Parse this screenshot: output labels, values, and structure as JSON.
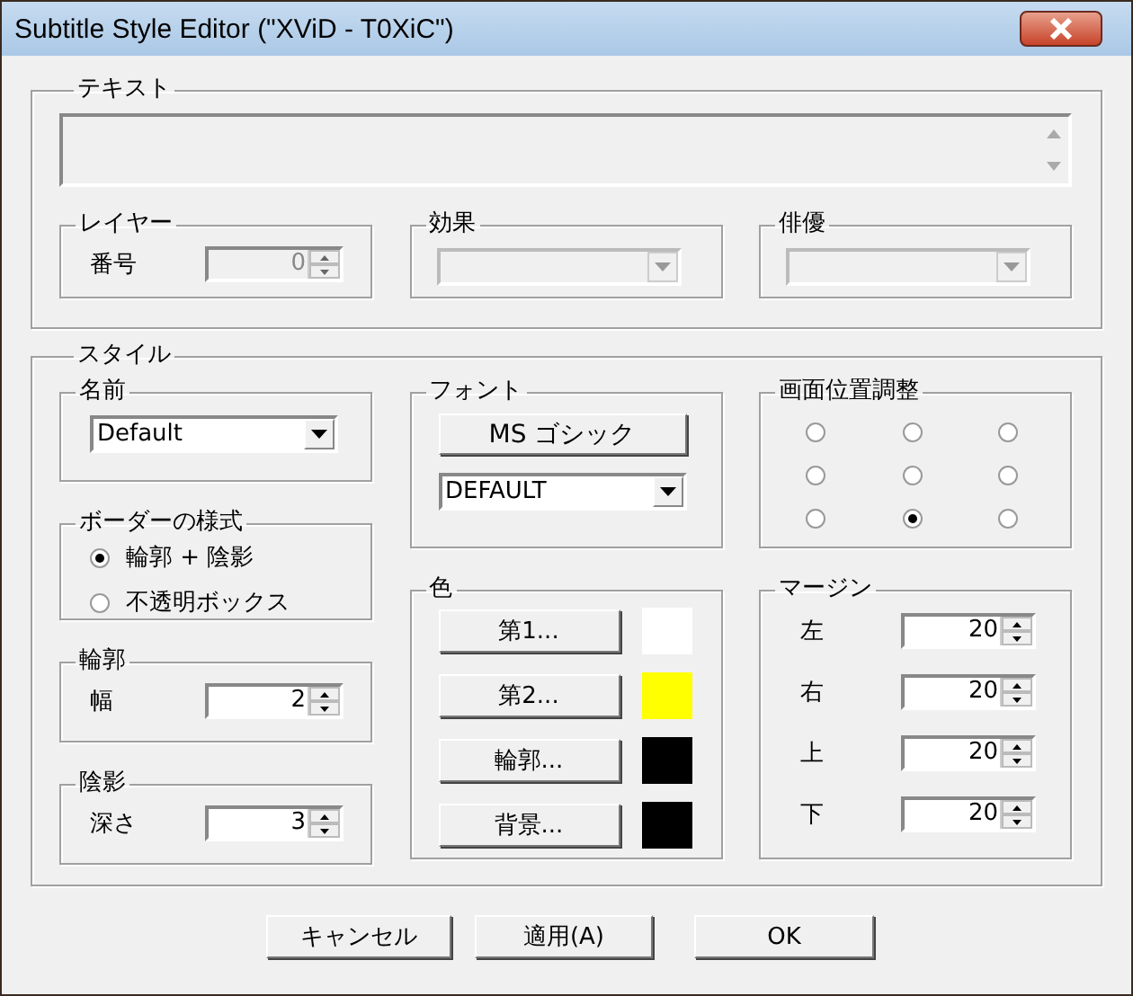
{
  "window": {
    "title": "Subtitle Style Editor (\"XViD - T0XiC\")"
  },
  "text_group": {
    "label": "テキスト",
    "layer": {
      "label": "レイヤー",
      "field_label": "番号",
      "value": "0",
      "disabled": true
    },
    "effect": {
      "label": "効果",
      "disabled": true
    },
    "actor": {
      "label": "俳優",
      "disabled": true
    }
  },
  "style": {
    "label": "スタイル",
    "name": {
      "label": "名前",
      "value": "Default"
    },
    "border_style": {
      "label": "ボーダーの様式",
      "options": [
        {
          "label": "輪郭 + 陰影",
          "selected": true
        },
        {
          "label": "不透明ボックス",
          "selected": false
        }
      ]
    },
    "outline": {
      "label": "輪郭",
      "field_label": "幅",
      "value": "2"
    },
    "shadow": {
      "label": "陰影",
      "field_label": "深さ",
      "value": "3"
    },
    "font": {
      "label": "フォント",
      "button": "MS ゴシック",
      "charset": "DEFAULT"
    },
    "colors": {
      "label": "色",
      "items": [
        {
          "label": "第1...",
          "color": "#ffffff"
        },
        {
          "label": "第2...",
          "color": "#ffff00"
        },
        {
          "label": "輪郭...",
          "color": "#000000"
        },
        {
          "label": "背景...",
          "color": "#000000"
        }
      ]
    },
    "position": {
      "label": "画面位置調整",
      "options": [
        {
          "selected": false
        },
        {
          "selected": false
        },
        {
          "selected": false
        },
        {
          "selected": false
        },
        {
          "selected": false
        },
        {
          "selected": false
        },
        {
          "selected": false
        },
        {
          "selected": true
        },
        {
          "selected": false
        }
      ]
    },
    "margin": {
      "label": "マージン",
      "items": [
        {
          "label": "左",
          "value": "20"
        },
        {
          "label": "右",
          "value": "20"
        },
        {
          "label": "上",
          "value": "20"
        },
        {
          "label": "下",
          "value": "20"
        }
      ]
    }
  },
  "buttons": [
    "キャンセル",
    "適用(A)",
    "OK"
  ]
}
